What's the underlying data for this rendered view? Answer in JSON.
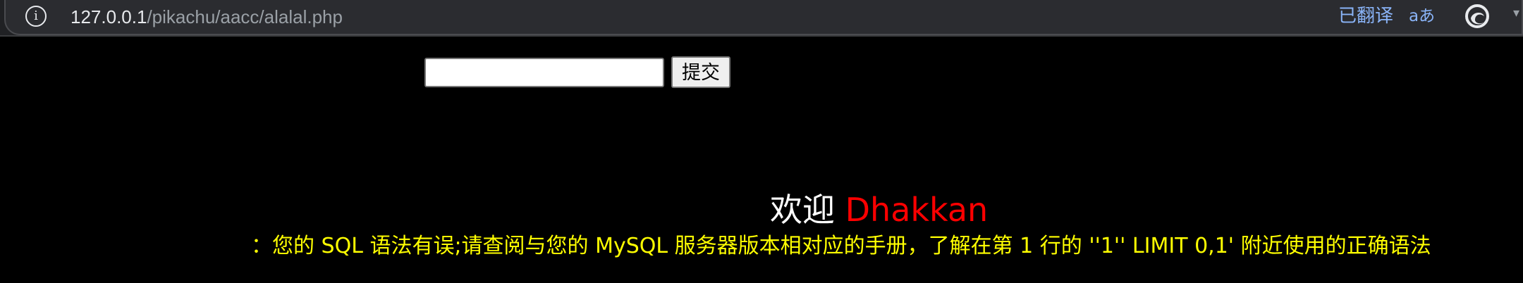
{
  "browser": {
    "url_host": "127.0.0.1",
    "url_path": "/pikachu/aacc/alalal.php",
    "translated_label": "已翻译",
    "translate_icon_text": "aあ",
    "info_icon_text": "i"
  },
  "form": {
    "input_value": "",
    "submit_label": "提交"
  },
  "welcome": {
    "prefix": "欢迎",
    "name": "Dhakkan"
  },
  "error_message": "：您的 SQL 语法有误;请查阅与您的 MySQL 服务器版本相对应的手册，了解在第 1 行的 ''1'' LIMIT 0,1' 附近使用的正确语法",
  "colors": {
    "page_background": "#000000",
    "welcome_text": "#ffffff",
    "name_text": "#ff0000",
    "error_text": "#ffff00",
    "translate_accent": "#8ab4f8"
  }
}
